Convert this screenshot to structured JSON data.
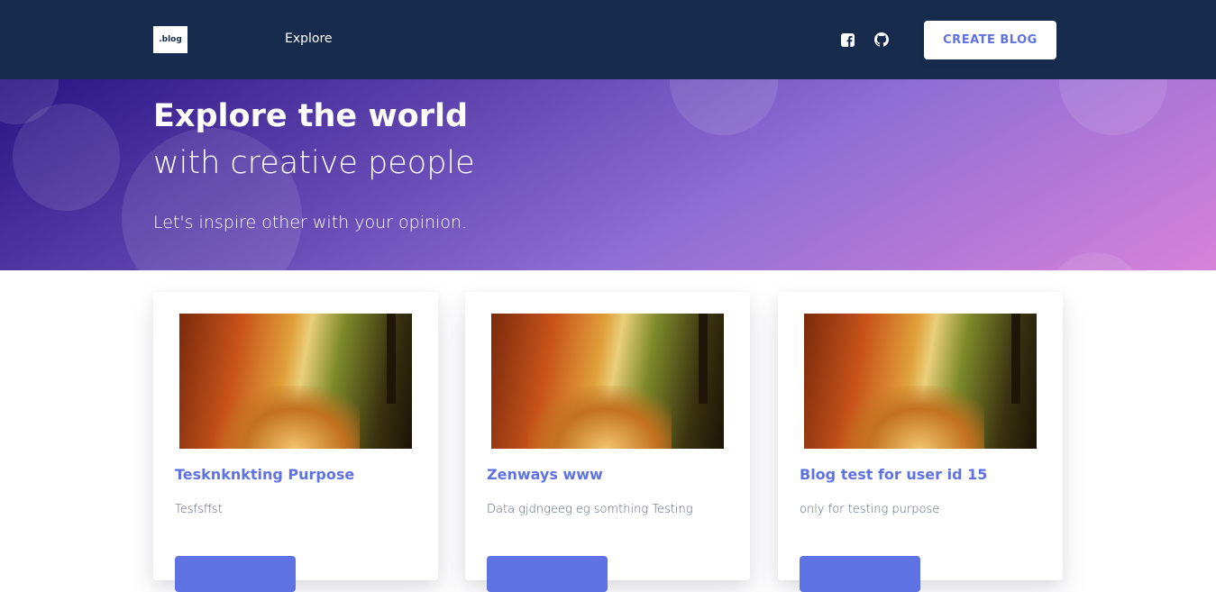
{
  "nav": {
    "logo_text": ".blog",
    "explore_label": "Explore",
    "create_button_label": "CREATE BLOG",
    "social_icons": [
      "facebook-square-icon",
      "github-icon"
    ]
  },
  "hero": {
    "title": "Explore the world",
    "subtitle": "with creative people",
    "lead": "Let's inspire other with your opinion."
  },
  "posts": [
    {
      "title": "Tesknknkting Purpose",
      "description": "Tesfsffst"
    },
    {
      "title": "Zenways www",
      "description": "Data gjdngeeg eg somthing Testing"
    },
    {
      "title": "Blog test for user id 15",
      "description": "only for testing purpose"
    }
  ],
  "colors": {
    "nav_bg": "#172b4d",
    "accent": "#5e72e4",
    "hero_gradient": [
      "#281483",
      "#8f6ed5",
      "#d782d9"
    ]
  }
}
